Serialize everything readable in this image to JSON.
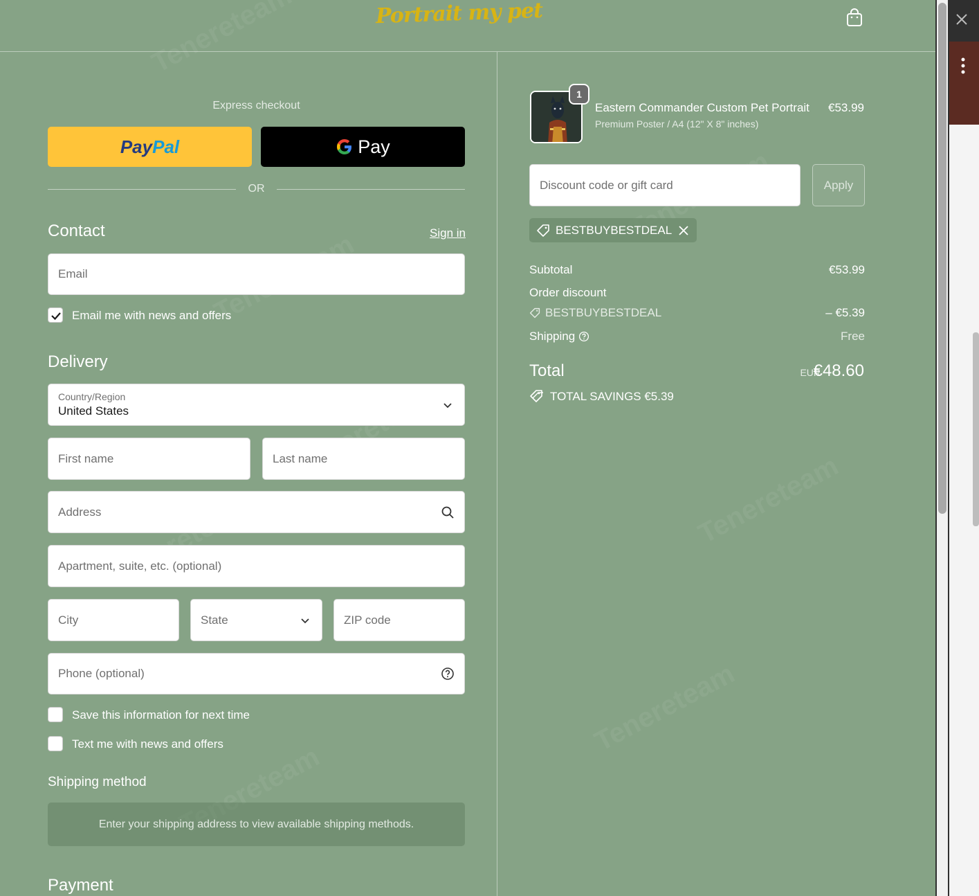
{
  "header": {
    "logo_text": "Portrait my pet",
    "cart_icon": "shopping-bag-icon"
  },
  "express": {
    "label": "Express checkout",
    "paypal_part1": "Pay",
    "paypal_part2": "Pal",
    "gpay_label": "Pay",
    "or_label": "OR"
  },
  "contact": {
    "title": "Contact",
    "sign_in": "Sign in",
    "email_placeholder": "Email",
    "news_label": "Email me with news and offers",
    "news_checked": true
  },
  "delivery": {
    "title": "Delivery",
    "country_label": "Country/Region",
    "country_value": "United States",
    "first_name": "First name",
    "last_name": "Last name",
    "address": "Address",
    "apartment": "Apartment, suite, etc. (optional)",
    "city": "City",
    "state": "State",
    "zip": "ZIP code",
    "phone": "Phone (optional)",
    "save_info": "Save this information for next time",
    "text_me": "Text me with news and offers"
  },
  "shipping": {
    "title": "Shipping method",
    "message": "Enter your shipping address to view available shipping methods."
  },
  "payment": {
    "title": "Payment"
  },
  "order": {
    "product_name": "Eastern Commander Custom Pet Portrait",
    "product_variant": "Premium Poster / A4 (12\" X 8\" inches)",
    "product_price": "€53.99",
    "quantity": "1",
    "discount_placeholder": "Discount code or gift card",
    "apply_label": "Apply",
    "code": "BESTBUYBESTDEAL",
    "subtotal_label": "Subtotal",
    "subtotal_value": "€53.99",
    "order_discount_label": "Order discount",
    "discount_code": "BESTBUYBESTDEAL",
    "discount_value": "– €5.39",
    "shipping_label": "Shipping",
    "shipping_value": "Free",
    "total_label": "Total",
    "currency": "EUR",
    "total_value": "€48.60",
    "savings": "TOTAL SAVINGS  €5.39"
  },
  "colors": {
    "background": "#86a386",
    "paypal_yellow": "#ffc439",
    "gpay_black": "#000000",
    "logo_gold": "#d8b414"
  }
}
